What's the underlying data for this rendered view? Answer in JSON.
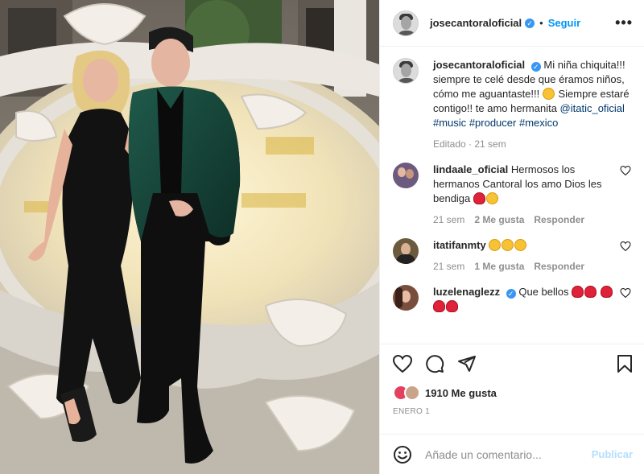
{
  "post": {
    "username": "josecantoraloficial",
    "verified_label": "✓",
    "follow_label": "Seguir",
    "dot": "•",
    "more_label": "•••",
    "caption_parts": {
      "text1": "Mi niña chiquita!!! siempre te celé desde que éramos niños, cómo me aguantaste!!! ",
      "text2": " Siempre estaré contigo!! te amo hermanita ",
      "mention": "@itatic_oficial",
      "tag1": "#music",
      "tag2": "#producer",
      "tag3": "#mexico"
    },
    "caption_meta": "Editado · 21 sem"
  },
  "comments": [
    {
      "username": "lindaale_oficial",
      "text": "Hermosos los hermanos Cantoral los amo Dios les bendiga",
      "time": "21 sem",
      "likes": "2 Me gusta",
      "reply": "Responder"
    },
    {
      "username": "itatifanmty",
      "text": "",
      "time": "21 sem",
      "likes": "1 Me gusta",
      "reply": "Responder"
    },
    {
      "username": "luzelenaglezz",
      "text": "Que bellos",
      "time": "",
      "likes": "",
      "reply": ""
    }
  ],
  "likes": {
    "count": "1910",
    "label": "Me gusta"
  },
  "date": "ENERO 1",
  "add_comment": {
    "placeholder": "Añade un comentario...",
    "publish": "Publicar"
  },
  "colors": {
    "accent": "#0095f6",
    "verified": "#3897f0",
    "muted": "#8e8e8e",
    "publish_disabled": "#b2dffc"
  },
  "icons": [
    "more-icon",
    "heart-icon",
    "comment-icon",
    "share-icon",
    "bookmark-icon",
    "emoji-icon",
    "verified-icon"
  ]
}
